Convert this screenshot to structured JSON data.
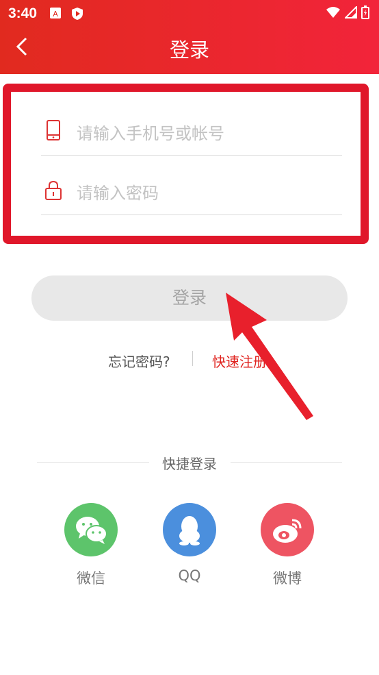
{
  "status_bar": {
    "time": "3:40"
  },
  "header": {
    "title": "登录"
  },
  "form": {
    "account_placeholder": "请输入手机号或帐号",
    "password_placeholder": "请输入密码"
  },
  "login_button": {
    "label": "登录"
  },
  "links": {
    "forgot": "忘记密码?",
    "register": "快速注册"
  },
  "quick_login": {
    "title": "快捷登录",
    "options": [
      {
        "label": "微信",
        "color": "#5dc46b",
        "icon": "wechat-icon"
      },
      {
        "label": "QQ",
        "color": "#4b8fdd",
        "icon": "qq-icon"
      },
      {
        "label": "微博",
        "color": "#ee5462",
        "icon": "weibo-icon"
      }
    ]
  },
  "colors": {
    "brand": "#e12a1f",
    "highlight": "#e0172a"
  }
}
